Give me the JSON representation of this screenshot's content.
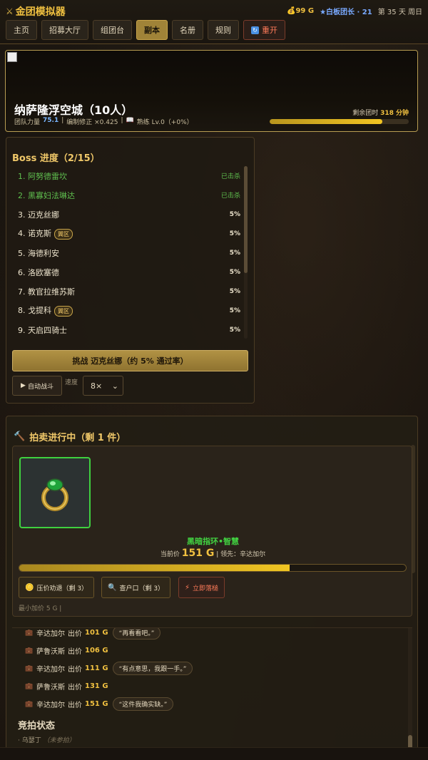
{
  "header": {
    "brand": "金团模拟器",
    "gold": "99 G",
    "rank": "★白板团长 · 21",
    "day": "第 35 天 周日"
  },
  "nav": {
    "items": [
      "主页",
      "招募大厅",
      "组团台",
      "副本",
      "名册",
      "规则"
    ],
    "active": "副本",
    "reset": "重开"
  },
  "raid": {
    "title": "纳萨隆浮空城（10人）",
    "power_label": "团队力量",
    "power_value": "75.1",
    "modifier": "编制修正 ×0.425",
    "proficiency": "熟练 Lv.0（+0%）",
    "time_label": "剩余团时",
    "time_value": "318 分钟",
    "time_ratio": 0.81
  },
  "boss": {
    "title": "Boss 进度（2/15）",
    "list": [
      {
        "name": "1. 阿努德雷坎",
        "status": "已击杀",
        "killed": true,
        "tag": ""
      },
      {
        "name": "2. 黑寡妇法琳达",
        "status": "已击杀",
        "killed": true,
        "tag": ""
      },
      {
        "name": "3. 迈克丝娜",
        "status": "5%",
        "killed": false,
        "tag": ""
      },
      {
        "name": "4. 诺克斯",
        "status": "5%",
        "killed": false,
        "tag": "翼区"
      },
      {
        "name": "5. 海德利安",
        "status": "5%",
        "killed": false,
        "tag": ""
      },
      {
        "name": "6. 洛欧塞德",
        "status": "5%",
        "killed": false,
        "tag": ""
      },
      {
        "name": "7. 教官拉维苏斯",
        "status": "5%",
        "killed": false,
        "tag": ""
      },
      {
        "name": "8. 戈提科",
        "status": "5%",
        "killed": false,
        "tag": "翼区"
      },
      {
        "name": "9. 天启四骑士",
        "status": "5%",
        "killed": false,
        "tag": ""
      }
    ],
    "challenge": "挑战 迈克丝娜（约 5% 通过率）",
    "auto": "自动战斗",
    "speed_label": "速度",
    "speed_value": "8×"
  },
  "auction": {
    "title": "拍卖进行中（剩 1 件）",
    "item_name": "黑暗指环•智慧",
    "current_label": "当前价",
    "current_price": "151 G",
    "leader": "领先：辛达加尔",
    "bid_ratio": 0.7,
    "btn_press": "压价劝退（剩 3）",
    "btn_check": "查户口（剩 3）",
    "btn_drop": "立即落槌",
    "min_inc": "最小加价 5 G  |",
    "log": [
      {
        "who": "辛达加尔",
        "act": "出价",
        "price": "101 G",
        "quote": "“再看看吧。”"
      },
      {
        "who": "萨鲁沃斯",
        "act": "出价",
        "price": "106 G",
        "quote": ""
      },
      {
        "who": "辛达加尔",
        "act": "出价",
        "price": "111 G",
        "quote": "“有点意思，我跟一手。”"
      },
      {
        "who": "萨鲁沃斯",
        "act": "出价",
        "price": "131 G",
        "quote": ""
      },
      {
        "who": "辛达加尔",
        "act": "出价",
        "price": "151 G",
        "quote": "“这件我确实缺。”"
      }
    ],
    "state_title": "竞拍状态",
    "state_name": "· 乌瑟丁",
    "state_note": "（未参拍）"
  },
  "colors": {
    "accent_gold": "#f0c040",
    "killed_green": "#5fc04f",
    "item_green": "#42d442",
    "danger": "#ff7b5a"
  }
}
